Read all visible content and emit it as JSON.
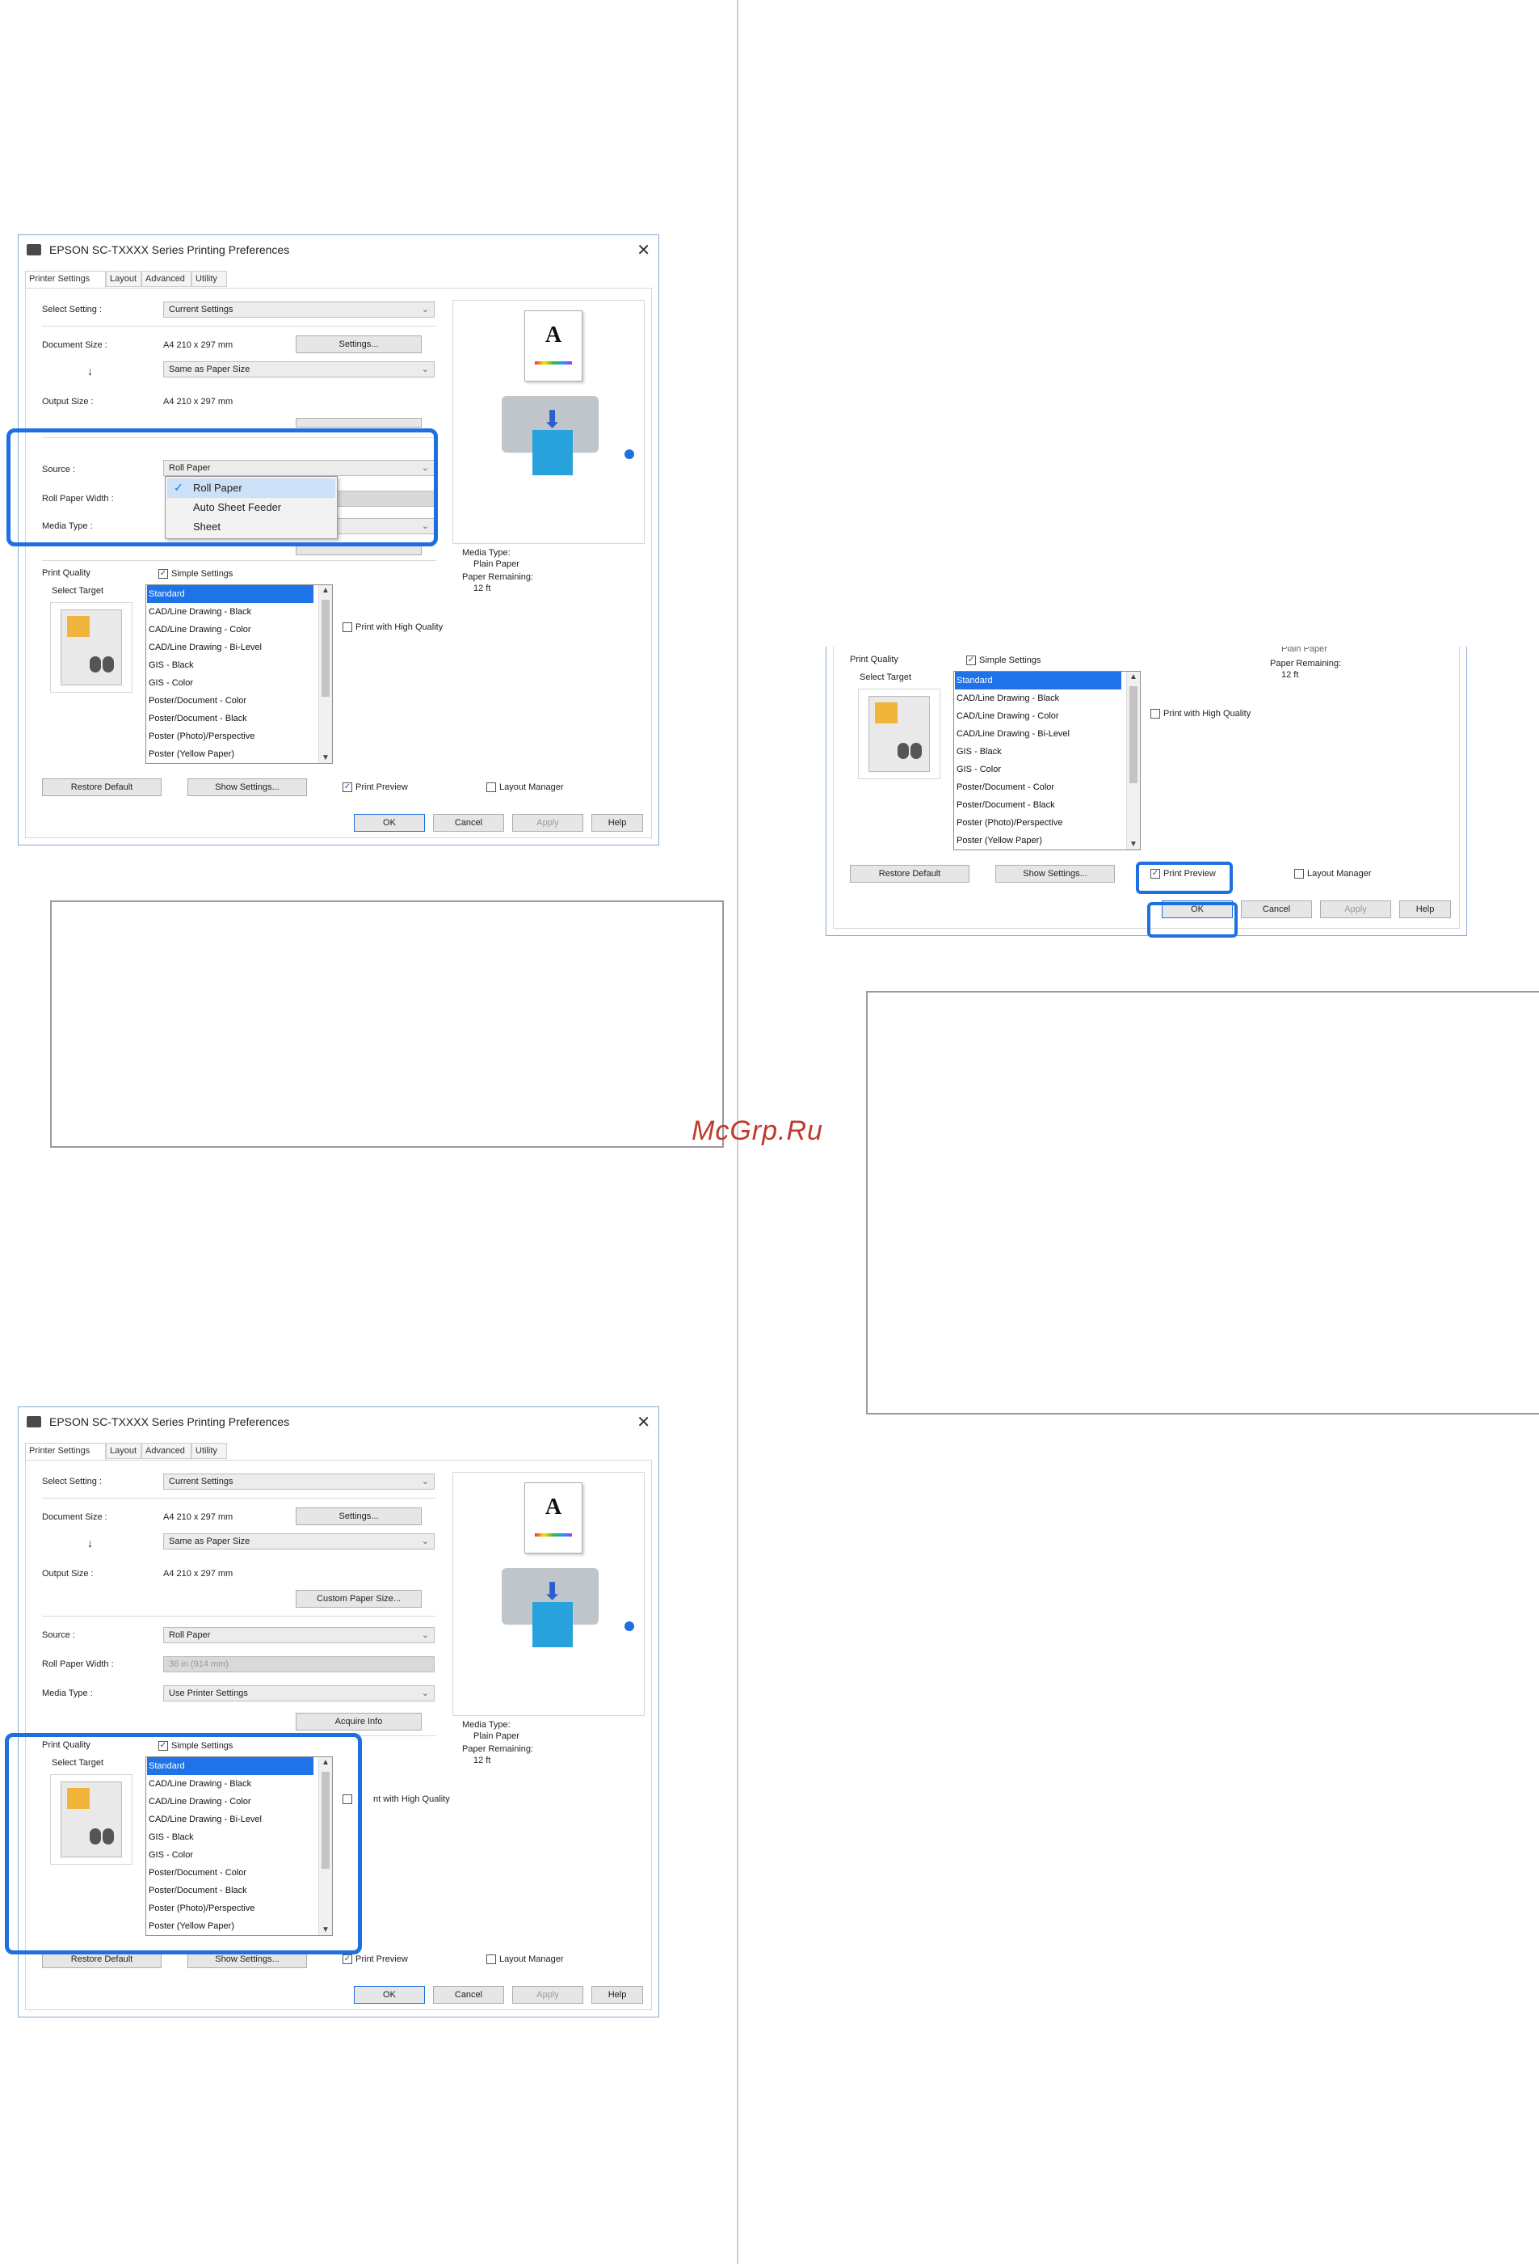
{
  "watermark": "McGrp.Ru",
  "dialog": {
    "title": "EPSON SC-TXXXX Series Printing Preferences",
    "close_glyph": "✕",
    "tabs": [
      "Printer Settings",
      "Layout",
      "Advanced",
      "Utility"
    ],
    "select_setting_label": "Select Setting :",
    "select_setting_value": "Current Settings",
    "document_size_label": "Document Size :",
    "document_size_value": "A4 210 x 297 mm",
    "settings_button": "Settings...",
    "arrow_down_glyph": "↓",
    "paper_size_value": "Same as Paper Size",
    "output_size_label": "Output Size :",
    "output_size_value": "A4 210 x 297 mm",
    "custom_paper_button": "Custom Paper Size...",
    "source_label": "Source :",
    "source_value": "Roll Paper",
    "roll_width_label": "Roll Paper Width :",
    "roll_width_value": "36 in (914 mm)",
    "media_type_label": "Media Type :",
    "media_type_value": "Use Printer Settings",
    "acquire_button": "Acquire Info",
    "print_quality_label": "Print Quality",
    "simple_settings_label": "Simple Settings",
    "select_target_label": "Select Target",
    "targets": [
      "Standard",
      "CAD/Line Drawing - Black",
      "CAD/Line Drawing - Color",
      "CAD/Line Drawing - Bi-Level",
      "GIS - Black",
      "GIS - Color",
      "Poster/Document - Color",
      "Poster/Document - Black",
      "Poster (Photo)/Perspective",
      "Poster (Yellow Paper)"
    ],
    "high_quality_label": "Print with High Quality",
    "high_quality_label_clipped": "nt with High Quality",
    "media_info_label": "Media Type:",
    "media_info_value": "Plain Paper",
    "paper_remaining_label": "Paper Remaining:",
    "paper_remaining_value": "12 ft",
    "restore_button": "Restore Default",
    "show_settings_button": "Show Settings...",
    "print_preview_label": "Print Preview",
    "layout_manager_label": "Layout Manager",
    "ok_button": "OK",
    "cancel_button": "Cancel",
    "apply_button": "Apply",
    "help_button": "Help",
    "preview_letter": "A",
    "source_options": [
      "Roll Paper",
      "Auto Sheet Feeder",
      "Sheet"
    ],
    "checkmark_glyph": "✓"
  },
  "colors": {
    "highlight": "#1e6fe0",
    "selection": "#1e73e8"
  }
}
